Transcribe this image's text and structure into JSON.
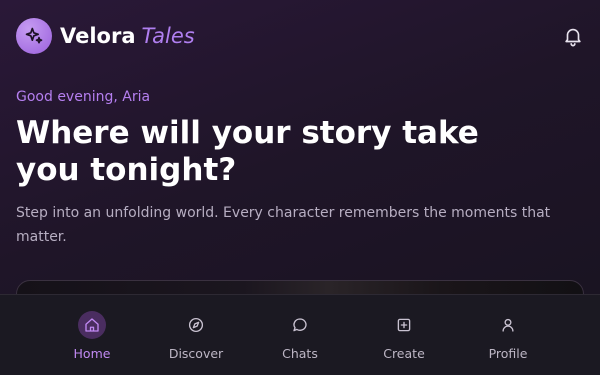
{
  "app": {
    "brand_main": "Velora",
    "brand_accent": "Tales"
  },
  "header": {
    "logo_icon": "sparkle-icon",
    "notification_icon": "bell-icon"
  },
  "hero": {
    "greeting": "Good evening, Aria",
    "headline": "Where will your story take you tonight?",
    "subtext": "Step into an unfolding world. Every character remembers the moments that matter."
  },
  "tabbar": {
    "items": [
      {
        "label": "Home",
        "icon": "home-icon",
        "active": true
      },
      {
        "label": "Discover",
        "icon": "compass-icon",
        "active": false
      },
      {
        "label": "Chats",
        "icon": "chat-bubble-icon",
        "active": false
      },
      {
        "label": "Create",
        "icon": "plus-square-icon",
        "active": false
      },
      {
        "label": "Profile",
        "icon": "user-icon",
        "active": false
      }
    ]
  },
  "colors": {
    "accent": "#b07ff0",
    "background": "#1f1528",
    "tabbar": "#1b1922",
    "active_tab_bg": "#4a2d60"
  }
}
